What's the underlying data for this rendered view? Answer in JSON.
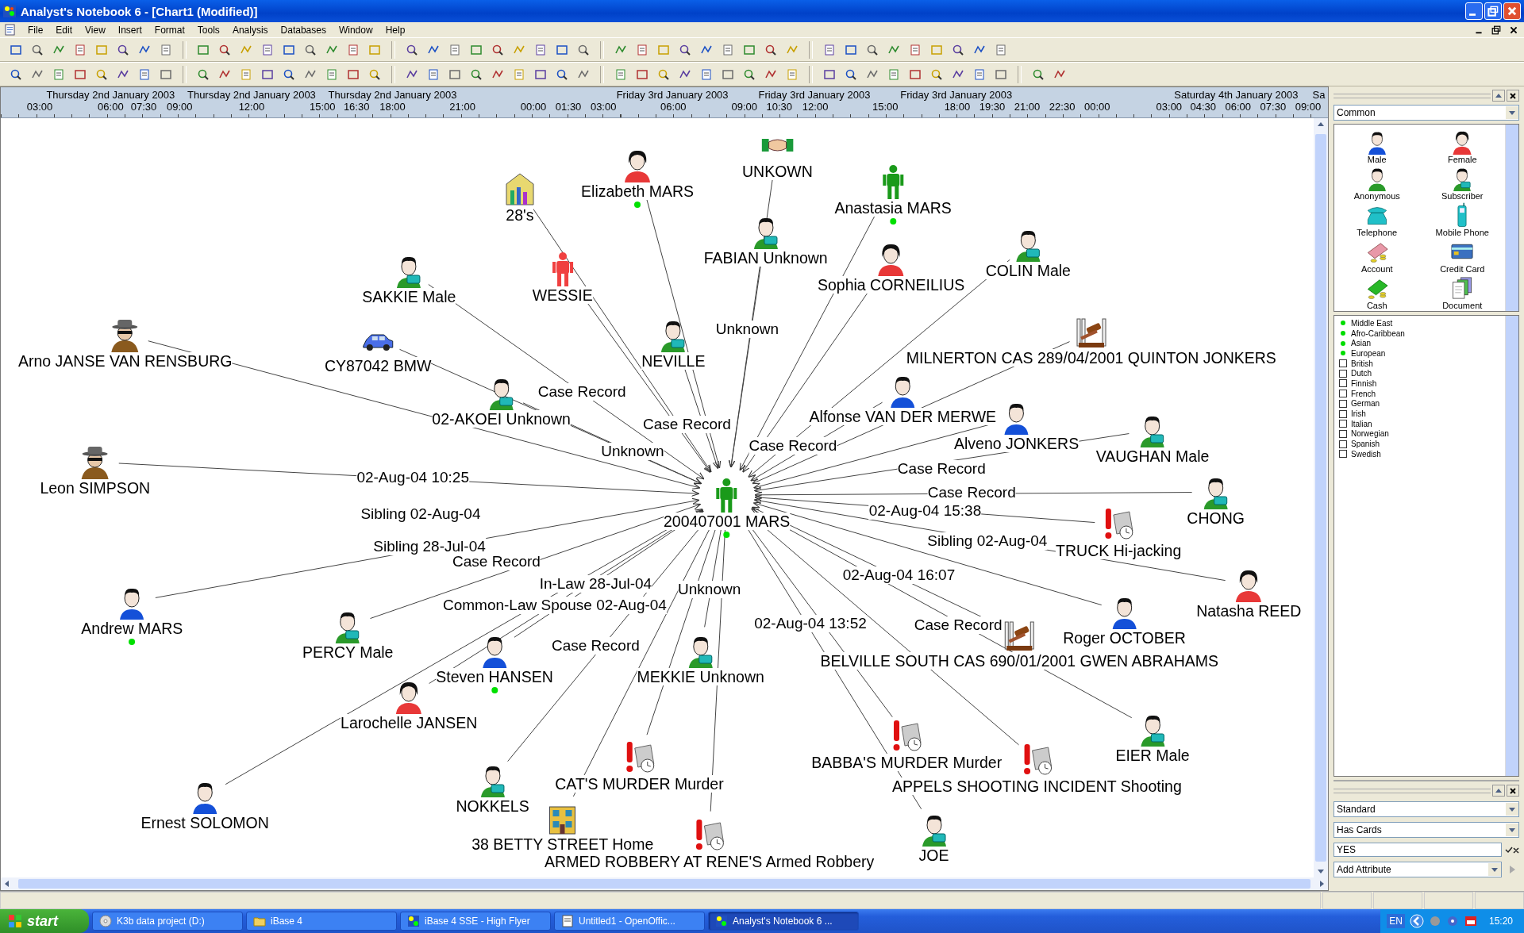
{
  "window": {
    "title": "Analyst's Notebook 6 - [Chart1 (Modified)]"
  },
  "menu": [
    "File",
    "Edit",
    "View",
    "Insert",
    "Format",
    "Tools",
    "Analysis",
    "Databases",
    "Window",
    "Help"
  ],
  "timeline": {
    "dates": [
      "Thursday 2nd January 2003",
      "Thursday 2nd January 2003",
      "Thursday 2nd January 2003",
      "Friday 3rd January 2003",
      "Friday 3rd January 2003",
      "Friday 3rd January 2003",
      "Saturday 4th January 2003",
      "Sa"
    ],
    "times": [
      "03:00",
      "06:00",
      "07:30",
      "09:00",
      "12:00",
      "15:00",
      "16:30",
      "18:00",
      "21:00",
      "00:00",
      "01:30",
      "03:00",
      "06:00",
      "09:00",
      "10:30",
      "12:00",
      "15:00",
      "18:00",
      "19:30",
      "21:00",
      "22:30",
      "00:00",
      "03:00",
      "04:30",
      "06:00",
      "07:30",
      "09:00"
    ]
  },
  "chart": {
    "entities": [
      {
        "label": "200407001 MARS",
        "kind": "person",
        "flag": true
      },
      {
        "label": "28's",
        "kind": "building",
        "flag": false
      },
      {
        "label": "Elizabeth MARS",
        "kind": "female",
        "flag": true
      },
      {
        "label": "UNKOWN",
        "kind": "handshake",
        "flag": false
      },
      {
        "label": "Anastasia MARS",
        "kind": "person",
        "flag": true
      },
      {
        "label": "FABIAN Unknown",
        "kind": "subscriber",
        "flag": false
      },
      {
        "label": "Sophia CORNEILIUS",
        "kind": "female",
        "flag": false
      },
      {
        "label": "COLIN Male",
        "kind": "subscriber",
        "flag": false
      },
      {
        "label": "SAKKIE Male",
        "kind": "subscriber",
        "flag": false
      },
      {
        "label": "WESSIE",
        "kind": "wanted",
        "flag": false
      },
      {
        "label": "Arno JANSE VAN RENSBURG",
        "kind": "disguised",
        "flag": false
      },
      {
        "label": "CY87042 BMW",
        "kind": "car",
        "flag": false
      },
      {
        "label": "NEVILLE",
        "kind": "subscriber",
        "flag": false
      },
      {
        "label": "MILNERTON CAS 289/04/2001 QUINTON JONKERS",
        "kind": "gavel",
        "flag": false
      },
      {
        "label": "Alfonse VAN DER MERWE",
        "kind": "male",
        "flag": false
      },
      {
        "label": "Alveno JONKERS",
        "kind": "male",
        "flag": false
      },
      {
        "label": "VAUGHAN Male",
        "kind": "subscriber",
        "flag": false
      },
      {
        "label": "02-AKOEI Unknown",
        "kind": "subscriber",
        "flag": false
      },
      {
        "label": "Leon SIMPSON",
        "kind": "disguised",
        "flag": false
      },
      {
        "label": "CHONG",
        "kind": "subscriber",
        "flag": false
      },
      {
        "label": "TRUCK Hi-jacking",
        "kind": "crime",
        "flag": false
      },
      {
        "label": "Natasha REED",
        "kind": "female",
        "flag": false
      },
      {
        "label": "Andrew MARS",
        "kind": "male",
        "flag": true
      },
      {
        "label": "PERCY Male",
        "kind": "subscriber",
        "flag": false
      },
      {
        "label": "Steven HANSEN",
        "kind": "male",
        "flag": true
      },
      {
        "label": "Larochelle JANSEN",
        "kind": "female",
        "flag": false
      },
      {
        "label": "MEKKIE Unknown",
        "kind": "subscriber",
        "flag": false
      },
      {
        "label": "Roger OCTOBER",
        "kind": "male",
        "flag": false
      },
      {
        "label": "BELVILLE SOUTH CAS 690/01/2001 GWEN ABRAHAMS",
        "kind": "gavel",
        "flag": false
      },
      {
        "label": "EIER Male",
        "kind": "subscriber",
        "flag": false
      },
      {
        "label": "BABBA'S MURDER Murder",
        "kind": "crime",
        "flag": false
      },
      {
        "label": "CAT'S MURDER Murder",
        "kind": "crime",
        "flag": false
      },
      {
        "label": "APPELS SHOOTING INCIDENT Shooting",
        "kind": "crime",
        "flag": false
      },
      {
        "label": "NOKKELS",
        "kind": "subscriber",
        "flag": false
      },
      {
        "label": "38 BETTY STREET Home",
        "kind": "house",
        "flag": false
      },
      {
        "label": "Ernest SOLOMON",
        "kind": "male",
        "flag": false
      },
      {
        "label": "ARMED ROBBERY AT RENE'S Armed Robbery",
        "kind": "crime",
        "flag": false
      },
      {
        "label": "JOE",
        "kind": "subscriber",
        "flag": false
      }
    ],
    "link_labels": [
      "Unknown",
      "Case Record",
      "Case Record",
      "Unknown",
      "02-Aug-04 10:25",
      "Sibling 02-Aug-04",
      "Sibling 28-Jul-04",
      "Case Record",
      "In-Law 28-Jul-04",
      "Common-Law Spouse 02-Aug-04",
      "Unknown",
      "Case Record",
      "Case Record",
      "Case Record",
      "Case Record",
      "02-Aug-04 15:38",
      "Sibling 02-Aug-04",
      "02-Aug-04 16:07",
      "02-Aug-04 13:52",
      "Case Record"
    ]
  },
  "palette": {
    "category": "Common",
    "items": [
      {
        "label": "Male",
        "kind": "male"
      },
      {
        "label": "Female",
        "kind": "female"
      },
      {
        "label": "Anonymous",
        "kind": "anonymous"
      },
      {
        "label": "Subscriber",
        "kind": "subscriber"
      },
      {
        "label": "Telephone",
        "kind": "telephone"
      },
      {
        "label": "Mobile Phone",
        "kind": "mobile"
      },
      {
        "label": "Account",
        "kind": "account"
      },
      {
        "label": "Credit Card",
        "kind": "card"
      },
      {
        "label": "Cash",
        "kind": "cash"
      },
      {
        "label": "Document",
        "kind": "document"
      }
    ],
    "attributes": [
      {
        "label": "Middle East",
        "kind": "legend"
      },
      {
        "label": "Afro-Caribbean",
        "kind": "legend"
      },
      {
        "label": "Asian",
        "kind": "legend"
      },
      {
        "label": "European",
        "kind": "legend"
      },
      {
        "label": "British",
        "kind": "checkbox",
        "checked": false
      },
      {
        "label": "Dutch",
        "kind": "checkbox",
        "checked": false
      },
      {
        "label": "Finnish",
        "kind": "checkbox",
        "checked": false
      },
      {
        "label": "French",
        "kind": "checkbox",
        "checked": false
      },
      {
        "label": "German",
        "kind": "checkbox",
        "checked": false
      },
      {
        "label": "Irish",
        "kind": "checkbox",
        "checked": false
      },
      {
        "label": "Italian",
        "kind": "checkbox",
        "checked": false
      },
      {
        "label": "Norwegian",
        "kind": "checkbox",
        "checked": false
      },
      {
        "label": "Spanish",
        "kind": "checkbox",
        "checked": false
      },
      {
        "label": "Swedish",
        "kind": "checkbox",
        "checked": false
      }
    ]
  },
  "attribute_panel": {
    "set": "Standard",
    "attribute": "Has Cards",
    "value": "YES",
    "add": "Add Attribute"
  },
  "taskbar": {
    "start": "start",
    "tasks": [
      {
        "label": "K3b data project (D:)",
        "kind": "disc",
        "selected": false
      },
      {
        "label": "iBase 4",
        "kind": "folder",
        "selected": false
      },
      {
        "label": "iBase 4 SSE - High Flyer",
        "kind": "app",
        "selected": false
      },
      {
        "label": "Untitled1 - OpenOffic...",
        "kind": "doc",
        "selected": false
      },
      {
        "label": "Analyst's Notebook 6 ...",
        "kind": "app",
        "selected": true
      }
    ],
    "language": "EN",
    "clock": "15:20"
  }
}
